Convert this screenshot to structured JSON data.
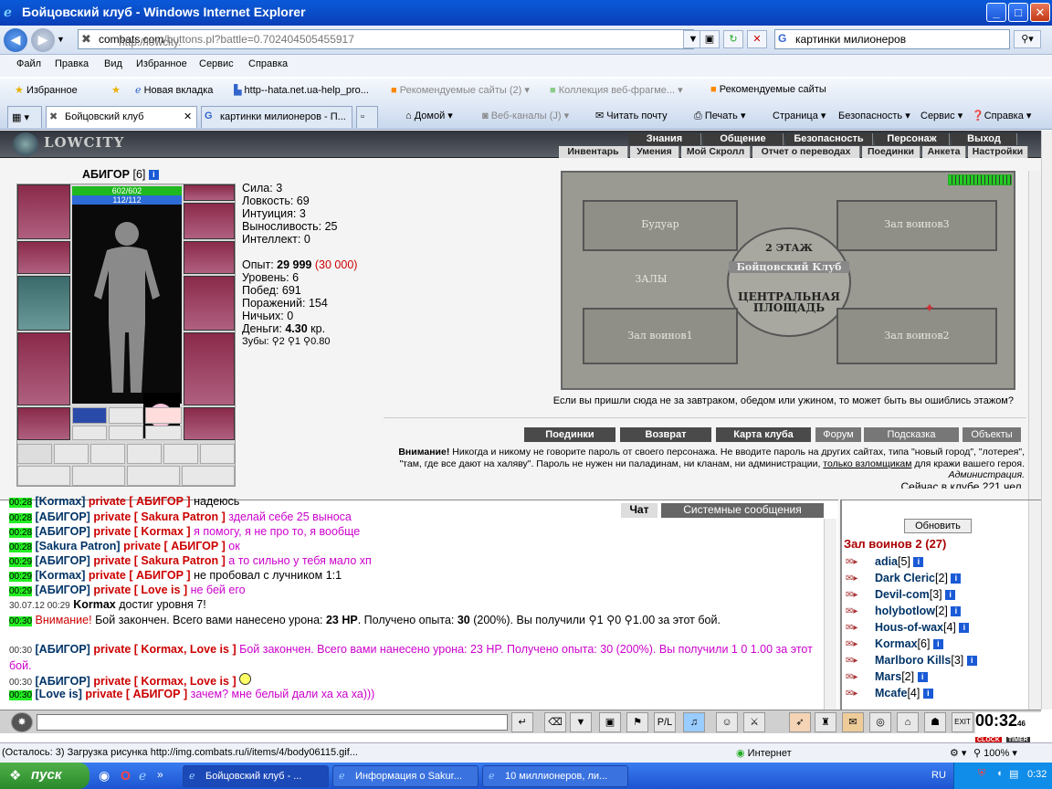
{
  "window": {
    "title": "Бойцовский клуб - Windows Internet Explorer"
  },
  "browser": {
    "url_prefix": "http://lowcity.",
    "url_domain": "combats.com",
    "url_suffix": "/buttons.pl?battle=0.702404505455917",
    "search_value": "картинки милионеров",
    "menu": [
      "Файл",
      "Правка",
      "Вид",
      "Избранное",
      "Сервис",
      "Справка"
    ],
    "favorites_label": "Избранное",
    "fav_links": [
      "Новая вкладка",
      "http--hata.net.ua-help_pro...",
      "Рекомендуемые сайты (2)",
      "Коллекция веб-фрагме...",
      "Рекомендуемые сайты"
    ],
    "tabs": [
      "Бойцовский клуб",
      "картинки милионеров - П..."
    ],
    "commands": [
      "Домой",
      "Веб-каналы (J)",
      "Читать почту",
      "Печать",
      "Страница",
      "Безопасность",
      "Сервис",
      "Справка"
    ]
  },
  "game": {
    "logo": "LOWCITY",
    "nav_top": [
      "Знания",
      "Общение",
      "Безопасность",
      "Персонаж",
      "Выход"
    ],
    "nav_sub": [
      "Инвентарь",
      "Умения",
      "Мой Скролл",
      "Отчет о переводах",
      "Поединки",
      "Анкета",
      "Настройки"
    ],
    "char_name": "АБИГОР",
    "char_level": "[6]",
    "hp": "602/602",
    "mp": "112/112",
    "stats": {
      "str": "Сила: 3",
      "agi": "Ловкость: 69",
      "int": "Интуиция: 3",
      "end": "Выносливость: 25",
      "wis": "Интеллект: 0",
      "exp_label": "Опыт: ",
      "exp_value": "29 999",
      "exp_next": "(30 000)",
      "level": "Уровень: 6",
      "wins": "Побед: 691",
      "losses": "Поражений: 154",
      "draws": "Ничьих: 0",
      "money_label": "Деньги: ",
      "money_value": "4.30",
      "money_unit": " кр.",
      "teeth": "Зубы: ⚲2 ⚲1 ⚲0.80"
    },
    "map": {
      "boudoir": "Будуар",
      "hall3": "Зал воинов3",
      "floor": "2 ЭТАЖ",
      "club": "Бойцовский Клуб",
      "halls": "ЗАЛЫ",
      "central": "ЦЕНТРАЛЬНАЯ ПЛОЩАДЬ",
      "hall1": "Зал воинов1",
      "hall2": "Зал воинов2"
    },
    "map_hint": "Если вы пришли сюда не за завтраком, обедом или ужином, то может быть вы ошиблись этажом?",
    "buttons": [
      "Поединки",
      "Возврат",
      "Карта клуба",
      "Форум",
      "Подсказка",
      "Объекты"
    ],
    "warning_bold": "Внимание!",
    "warning_text": " Никогда и никому не говорите пароль от своего персонажа. Не вводите пароль на других сайтах, типа \"новый город\", \"лотерея\", \"там, где все дают на халяву\". Пароль не нужен ни паладинам, ни кланам, ни администрации, ",
    "warning_link": "только взломщикам",
    "warning_end": " для кражи вашего героя.",
    "admin": "Администрация.",
    "online": "Сейчас в клубе 221 чел."
  },
  "chat": {
    "tab_chat": "Чат",
    "tab_system": "Системные сообщения",
    "lines": [
      {
        "ts": "00:28",
        "from": "[Kormax]",
        "priv": "private [ АБИГОР ]",
        "msg": "надеюсь"
      },
      {
        "ts": "00:28",
        "from": "[АБИГОР]",
        "priv": "private [ Sakura Patron ]",
        "msg": "зделай себе 25 выноса"
      },
      {
        "ts": "00:28",
        "from": "[АБИГОР]",
        "priv": "private [ Kormax ]",
        "msg": "я помогу, я не про то, я вообще"
      },
      {
        "ts": "00:28",
        "from": "[Sakura Patron]",
        "priv": "private [ АБИГОР ]",
        "msg": "ок"
      },
      {
        "ts": "00:29",
        "from": "[АБИГОР]",
        "priv": "private [ Sakura Patron ]",
        "msg": "а то сильно у тебя мало хп"
      },
      {
        "ts": "00:29",
        "from": "[Kormax]",
        "priv": "private [ АБИГОР ]",
        "msg": "не пробовал с лучником 1:1"
      },
      {
        "ts": "00:29",
        "from": "[АБИГОР]",
        "priv": "private [ Love is ]",
        "msg": "не бей его"
      }
    ],
    "level_up_date": "30.07.12 00:29",
    "level_up_name": "Kormax",
    "level_up_msg": "достиг уровня 7!",
    "sys_ts": "00:30",
    "sys_attn": "Внимание!",
    "sys_msg1": "Бой закончен. Всего вами нанесено урона: ",
    "sys_dmg": "23 HP",
    "sys_msg2": ". Получено опыта: ",
    "sys_exp": "30",
    "sys_msg3": " (200%). Вы получили ⚲1 ⚲0 ⚲1.00 за этот",
    "sys_msg4": "бой.",
    "line_b_ts": "00:30",
    "line_b_from": "[АБИГОР]",
    "line_b_priv": "private [ Kormax, Love is ]",
    "line_b_msg": "Бой закончен. Всего вами нанесено урона: 23 HP. Получено опыта: 30 (200%). Вы",
    "line_b_msg2": "получили 1 0 1.00 за этот бой.",
    "line_c_ts": "00:30",
    "line_c_from": "[АБИГОР]",
    "line_c_priv": "private [ Kormax, Love is ]",
    "line_d_ts": "00:30",
    "line_d_from": "[Love is]",
    "line_d_priv": "private [ АБИГОР ]",
    "line_d_msg": "зачем? мне белый дали ха ха ха)))"
  },
  "users": {
    "refresh": "Обновить",
    "room": "Зал воинов 2 (27)",
    "list": [
      {
        "name": "adia",
        "lvl": "[5]"
      },
      {
        "name": "Dark Cleric",
        "lvl": "[2]"
      },
      {
        "name": "Devil-com",
        "lvl": "[3]"
      },
      {
        "name": "holybotlow",
        "lvl": "[2]"
      },
      {
        "name": "Hous-of-wax",
        "lvl": "[4]"
      },
      {
        "name": "Kormax",
        "lvl": "[6]"
      },
      {
        "name": "Marlboro Kills",
        "lvl": "[3]"
      },
      {
        "name": "Mars",
        "lvl": "[2]"
      },
      {
        "name": "Mcafe",
        "lvl": "[4]"
      }
    ]
  },
  "clock": {
    "time": "00:32",
    "sec": "46",
    "clock_label": "CLOCK",
    "timer_label": "TIMER"
  },
  "statusbar": {
    "text": "(Осталось: 3) Загрузка рисунка http://img.combats.ru/i/items/4/body06115.gif...",
    "zone": "Интернет",
    "zoom": "100%"
  },
  "taskbar": {
    "start": "пуск",
    "tasks": [
      "Бойцовский клуб - ...",
      "Информация о Sakur...",
      "10 миллионеров, ли..."
    ],
    "lang": "RU",
    "time": "0:32"
  }
}
